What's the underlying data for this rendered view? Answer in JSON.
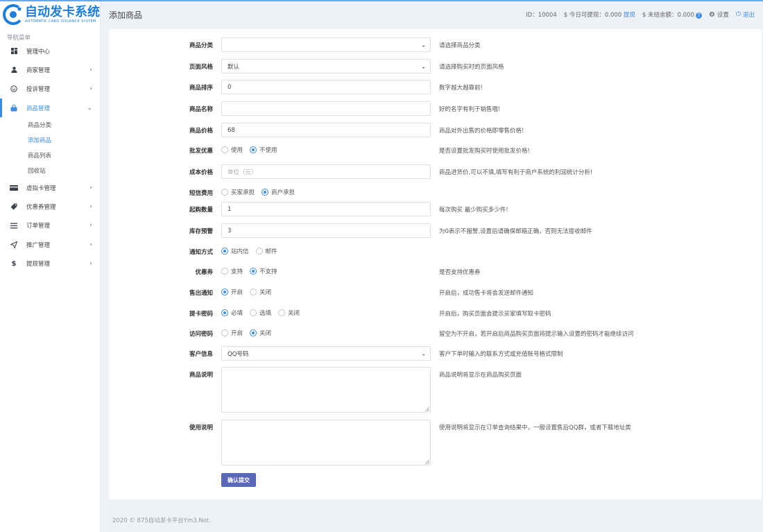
{
  "app": {
    "logo_title": "自动发卡系统",
    "logo_subtitle": "AUTOMATIC CARD ISSUANCE SYSTEM",
    "brand_color": "#1f7fd6",
    "accent_color": "#3d8bd9"
  },
  "sidebar": {
    "caption": "导航菜单",
    "items": [
      {
        "label": "管理中心",
        "icon": "dashboard-icon"
      },
      {
        "label": "商家管理",
        "icon": "user-icon"
      },
      {
        "label": "投诉管理",
        "icon": "smiley-icon"
      },
      {
        "label": "商品管理",
        "icon": "bag-icon"
      },
      {
        "label": "虚拟卡管理",
        "icon": "card-icon"
      },
      {
        "label": "优惠券管理",
        "icon": "tag-icon"
      },
      {
        "label": "订单管理",
        "icon": "list-icon"
      },
      {
        "label": "推广管理",
        "icon": "send-icon"
      },
      {
        "label": "提现管理",
        "icon": "dollar-icon"
      }
    ],
    "sub_items": [
      "商品分类",
      "添加商品",
      "商品列表",
      "回收站"
    ]
  },
  "header": {
    "title": "添加商品",
    "id_text": "ID：10004",
    "withdrawable_text": "$ 今日可提现：0.000",
    "withdraw_link": "提现",
    "unsettled_text": "$ 未结余额：0.000",
    "unsettled_badge": "?",
    "settings": "设置",
    "logout": "退出"
  },
  "form": {
    "category": {
      "label": "商品分类",
      "value": "",
      "hint": "请选择商品分类"
    },
    "theme": {
      "label": "页面风格",
      "value": "默认",
      "hint": "请选择购买时的页面风格"
    },
    "sort": {
      "label": "商品排序",
      "value": "0",
      "hint": "数字越大越靠前!"
    },
    "name": {
      "label": "商品名称",
      "value": "",
      "hint": "好的名字有利于销售哦!"
    },
    "price": {
      "label": "商品价格",
      "value": "68",
      "hint": "商品对外出售的价格即零售价格!"
    },
    "wholesale": {
      "label": "批发优惠",
      "options": [
        "使用",
        "不使用"
      ],
      "selected": 1,
      "hint": "是否设置批发购买时使用批发价格!"
    },
    "cost": {
      "label": "成本价格",
      "placeholder": "单位（元）",
      "hint": "商品进货价,可以不填,填写有利于商户系统的利润统计分析!"
    },
    "sms": {
      "label": "短信费用",
      "options": [
        "买家承担",
        "商户承担"
      ],
      "selected": 1
    },
    "min_qty": {
      "label": "起购数量",
      "value": "1",
      "hint": "每次购买 最少购买多少件!"
    },
    "stock_alert": {
      "label": "库存预警",
      "value": "3",
      "hint": "为0表示不报警,设置后请确保邮箱正确，否则无法接收邮件"
    },
    "notify": {
      "label": "通知方式",
      "options": [
        "站内信",
        "邮件"
      ],
      "selected": 0
    },
    "coupon": {
      "label": "优惠券",
      "options": [
        "支持",
        "不支持"
      ],
      "selected": 1,
      "hint": "是否支持优惠券"
    },
    "sold_notify": {
      "label": "售出通知",
      "options": [
        "开启",
        "关闭"
      ],
      "selected": 0,
      "hint": "开启后，成功售卡将会发送邮件通知"
    },
    "pickup_pwd": {
      "label": "提卡密码",
      "options": [
        "必填",
        "选填",
        "关闭"
      ],
      "selected": 0,
      "hint": "开启后，购买页面会提示买家填写取卡密码"
    },
    "access_pwd": {
      "label": "访问密码",
      "options": [
        "开启",
        "关闭"
      ],
      "selected": 1,
      "hint": "留空为不开启，若开启后商品购买页面将提示输入设置的密码才能继续访问"
    },
    "customer_info": {
      "label": "客户信息",
      "value": "QQ号码",
      "hint": "客户下单时输入的联系方式或充值账号格式限制"
    },
    "description": {
      "label": "商品说明",
      "hint": "商品说明将显示在商品购买页面"
    },
    "usage": {
      "label": "使用说明",
      "hint": "使用说明将显示在订单查询结果中，一般设置售后QQ群，或者下载地址类"
    },
    "submit_label": "确认提交"
  },
  "footer": {
    "text": "2020 © 875自动发卡平台Ym3.Net."
  }
}
